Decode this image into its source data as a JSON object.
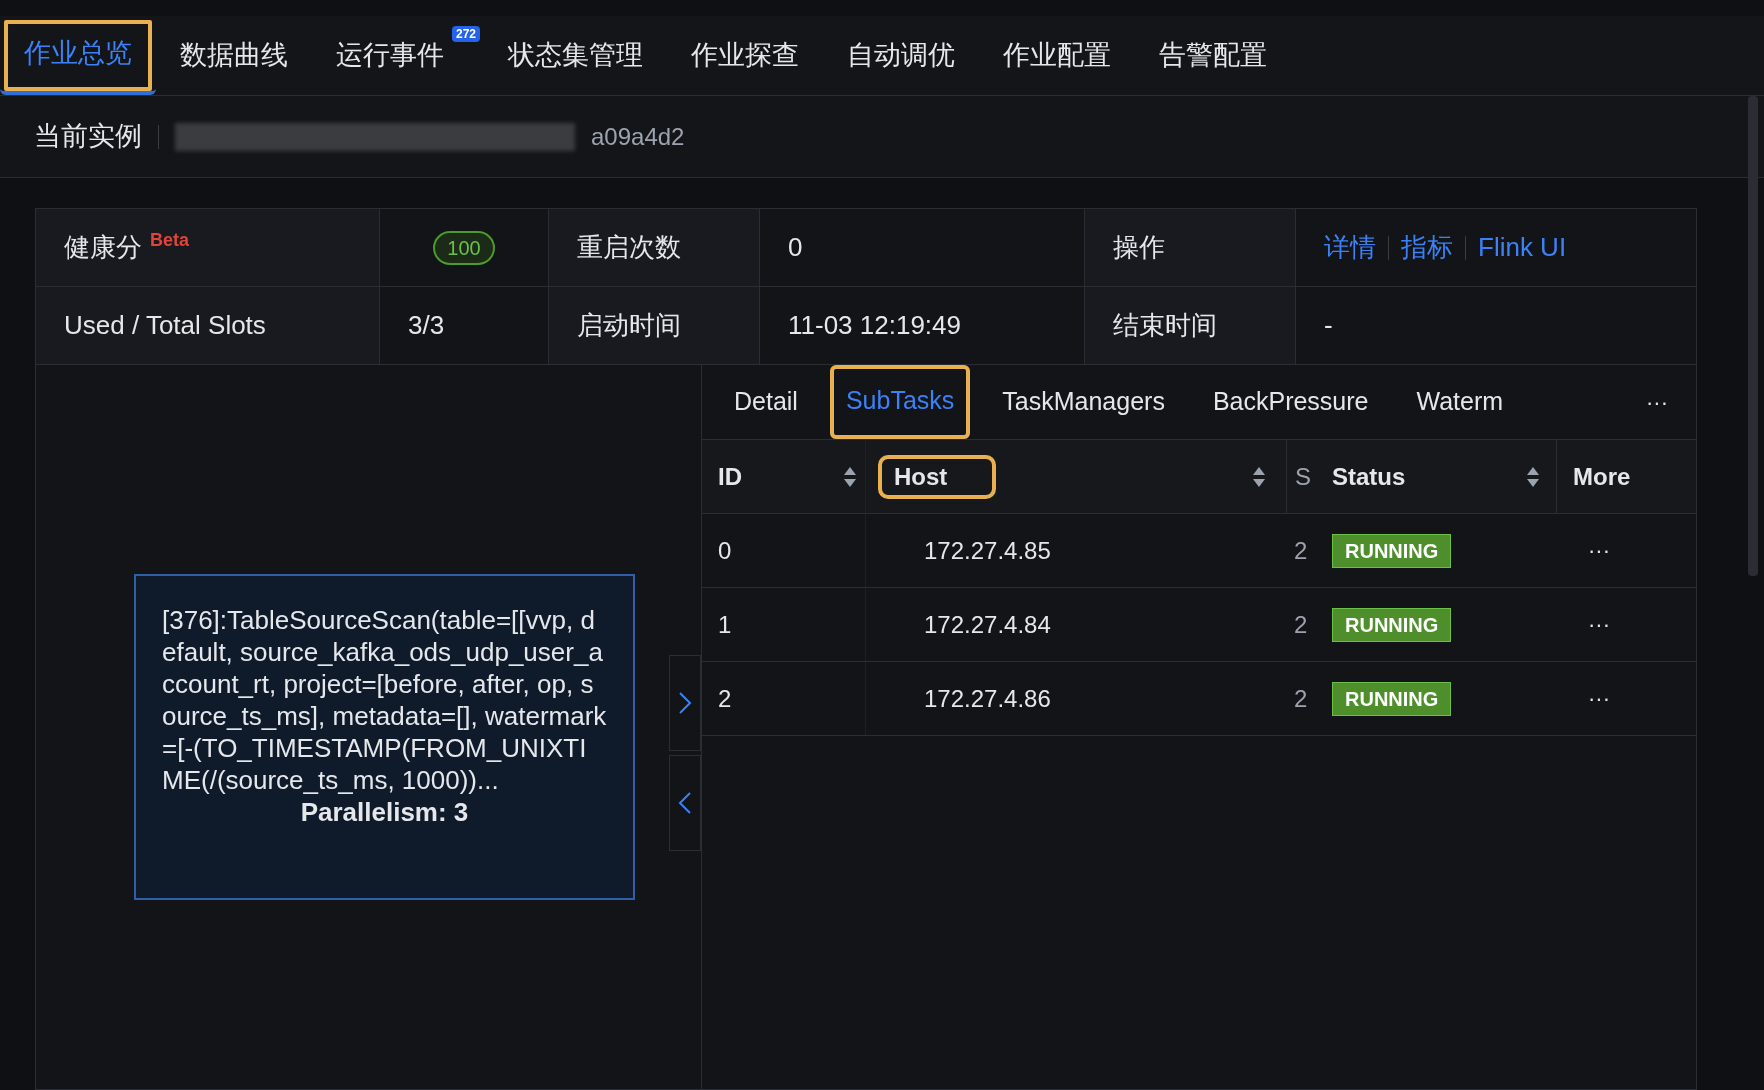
{
  "top_tabs": [
    {
      "label": "作业总览",
      "selected": true
    },
    {
      "label": "数据曲线",
      "selected": false
    },
    {
      "label": "运行事件",
      "selected": false,
      "badge": "272"
    },
    {
      "label": "状态集管理",
      "selected": false
    },
    {
      "label": "作业探查",
      "selected": false
    },
    {
      "label": "自动调优",
      "selected": false
    },
    {
      "label": "作业配置",
      "selected": false
    },
    {
      "label": "告警配置",
      "selected": false
    }
  ],
  "instance": {
    "label": "当前实例",
    "value_visible": "a09a4d2"
  },
  "info": {
    "health_label": "健康分",
    "health_tag": "Beta",
    "health_score": "100",
    "restart_label": "重启次数",
    "restart_value": "0",
    "ops_label": "操作",
    "links": [
      "详情",
      "指标",
      "Flink UI"
    ],
    "slots_label": "Used / Total Slots",
    "slots_value": "3/3",
    "start_label": "启动时间",
    "start_value": "11-03 12:19:49",
    "end_label": "结束时间",
    "end_value": "-"
  },
  "node": {
    "text": "[376]:TableSourceScan(table=[[vvp, default, source_kafka_ods_udp_user_account_rt, project=[before, after, op, source_ts_ms], metadata=[], watermark=[-(TO_TIMESTAMP(FROM_UNIXTIME(/(source_ts_ms, 1000))...",
    "parallelism": "Parallelism: 3"
  },
  "sub_tabs": [
    {
      "label": "Detail",
      "selected": false
    },
    {
      "label": "SubTasks",
      "selected": true
    },
    {
      "label": "TaskManagers",
      "selected": false
    },
    {
      "label": "BackPressure",
      "selected": false
    },
    {
      "label": "Waterm",
      "selected": false
    }
  ],
  "sub_tabs_more": "···",
  "table": {
    "columns": [
      "ID",
      "Host",
      "S",
      "Status",
      "More"
    ],
    "rows": [
      {
        "id": "0",
        "host": "172.27.4.85",
        "column_3": "2",
        "status": "RUNNING",
        "more": "···"
      },
      {
        "id": "1",
        "host": "172.27.4.84",
        "column_3": "2",
        "status": "RUNNING",
        "more": "···"
      },
      {
        "id": "2",
        "host": "172.27.4.86",
        "column_3": "2",
        "status": "RUNNING",
        "more": "···"
      }
    ]
  }
}
